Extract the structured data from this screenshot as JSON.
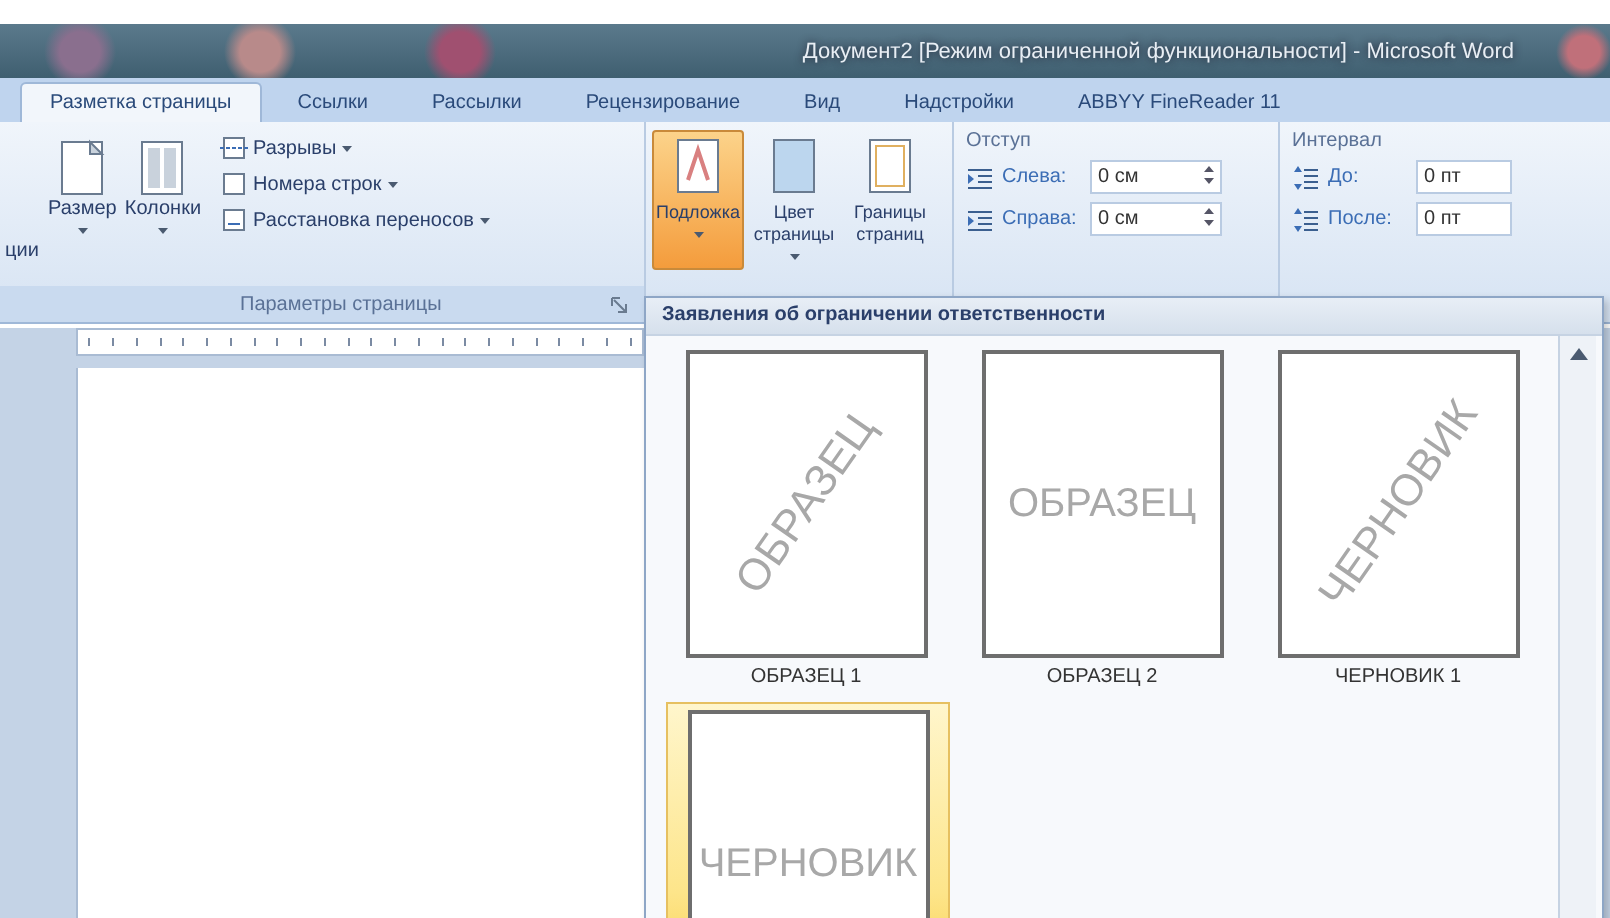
{
  "window": {
    "title": "Документ2 [Режим ограниченной функциональности] - Microsoft Word"
  },
  "tabs": [
    {
      "label": "Разметка страницы",
      "selected": true
    },
    {
      "label": "Ссылки",
      "selected": false
    },
    {
      "label": "Рассылки",
      "selected": false
    },
    {
      "label": "Рецензирование",
      "selected": false
    },
    {
      "label": "Вид",
      "selected": false
    },
    {
      "label": "Надстройки",
      "selected": false
    },
    {
      "label": "ABBYY FineReader 11",
      "selected": false
    }
  ],
  "page_setup": {
    "label": "Параметры страницы",
    "big_buttons": [
      {
        "label": "ции",
        "kind": "orientation"
      },
      {
        "label": "Размер",
        "kind": "size"
      },
      {
        "label": "Колонки",
        "kind": "columns"
      }
    ],
    "small_buttons": [
      {
        "label": "Разрывы",
        "kind": "breaks"
      },
      {
        "label": "Номера строк",
        "kind": "numbers"
      },
      {
        "label": "Расстановка переносов",
        "kind": "hyphen"
      }
    ]
  },
  "page_background": {
    "buttons": [
      {
        "label": "Подложка",
        "kind": "watermark",
        "selected": true
      },
      {
        "label": "Цвет страницы",
        "kind": "color",
        "selected": false
      },
      {
        "label": "Границы страниц",
        "kind": "borders",
        "selected": false
      }
    ]
  },
  "indent": {
    "label": "Отступ",
    "fields": [
      {
        "label": "Слева:",
        "value": "0 см"
      },
      {
        "label": "Справа:",
        "value": "0 см"
      }
    ]
  },
  "spacing": {
    "label": "Интервал",
    "fields": [
      {
        "label": "До:",
        "value": "0 пт"
      },
      {
        "label": "После:",
        "value": "0 пт"
      }
    ]
  },
  "gallery": {
    "header": "Заявления об ограничении ответственности",
    "items": [
      {
        "label": "ОБРАЗЕЦ 1",
        "watermark": "ОБРАЗЕЦ",
        "kind": "diagonal",
        "selected": false
      },
      {
        "label": "ОБРАЗЕЦ 2",
        "watermark": "ОБРАЗЕЦ",
        "kind": "horizontal",
        "selected": false
      },
      {
        "label": "ЧЕРНОВИК 1",
        "watermark": "ЧЕРНОВИК",
        "kind": "diagonal",
        "selected": false
      },
      {
        "watermark": "ЧЕРНОВИК",
        "kind": "horizontal",
        "selected": true
      }
    ]
  }
}
